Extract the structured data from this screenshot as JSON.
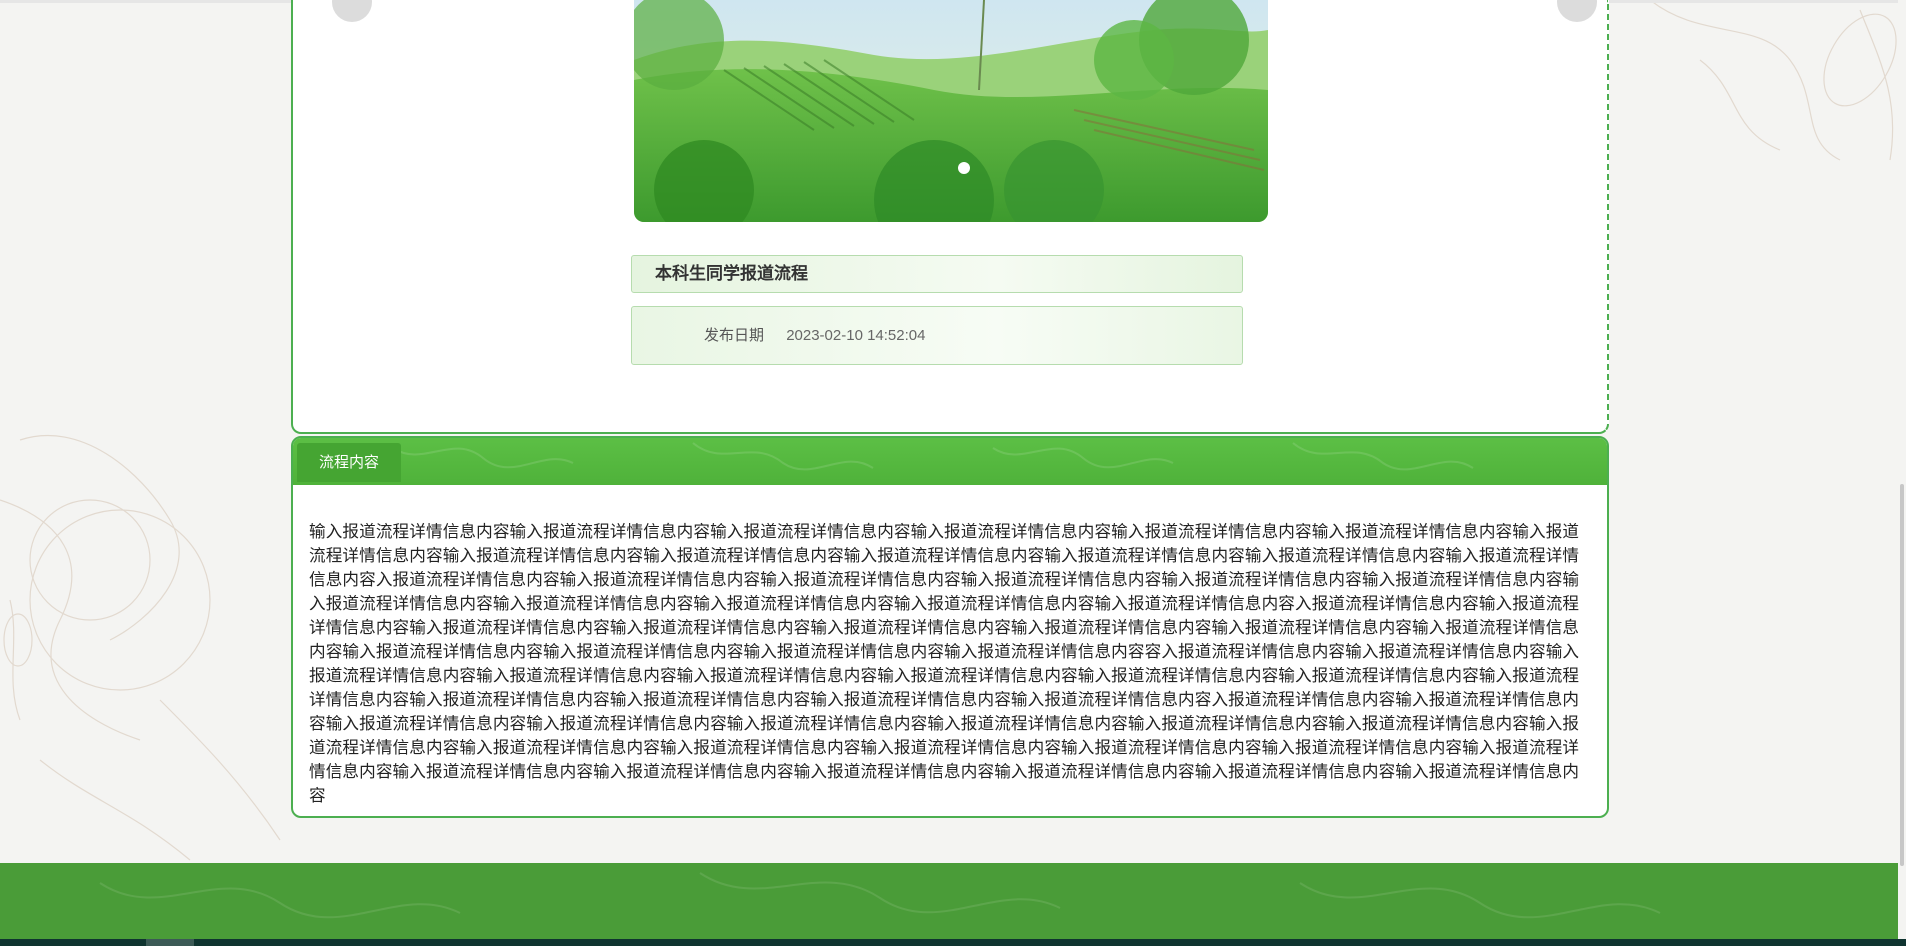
{
  "article": {
    "title": "本科生同学报道流程",
    "date_label": "发布日期",
    "date_value": "2023-02-10 14:52:04"
  },
  "content_section": {
    "tab_label": "流程内容",
    "body": "输入报道流程详情信息内容输入报道流程详情信息内容输入报道流程详情信息内容输入报道流程详情信息内容输入报道流程详情信息内容输入报道流程详情信息内容输入报道流程详情信息内容输入报道流程详情信息内容输入报道流程详情信息内容输入报道流程详情信息内容输入报道流程详情信息内容输入报道流程详情信息内容输入报道流程详情信息内容入报道流程详情信息内容输入报道流程详情信息内容输入报道流程详情信息内容输入报道流程详情信息内容输入报道流程详情信息内容输入报道流程详情信息内容输入报道流程详情信息内容输入报道流程详情信息内容输入报道流程详情信息内容输入报道流程详情信息内容输入报道流程详情信息内容入报道流程详情信息内容输入报道流程详情信息内容输入报道流程详情信息内容输入报道流程详情信息内容输入报道流程详情信息内容输入报道流程详情信息内容输入报道流程详情信息内容输入报道流程详情信息内容输入报道流程详情信息内容输入报道流程详情信息内容输入报道流程详情信息内容输入报道流程详情信息内容容入报道流程详情信息内容输入报道流程详情信息内容输入报道流程详情信息内容输入报道流程详情信息内容输入报道流程详情信息内容输入报道流程详情信息内容输入报道流程详情信息内容输入报道流程详情信息内容输入报道流程详情信息内容输入报道流程详情信息内容输入报道流程详情信息内容输入报道流程详情信息内容输入报道流程详情信息内容入报道流程详情信息内容输入报道流程详情信息内容输入报道流程详情信息内容输入报道流程详情信息内容输入报道流程详情信息内容输入报道流程详情信息内容输入报道流程详情信息内容输入报道流程详情信息内容输入报道流程详情信息内容输入报道流程详情信息内容输入报道流程详情信息内容输入报道流程详情信息内容输入报道流程详情信息内容输入报道流程详情信息内容输入报道流程详情信息内容输入报道流程详情信息内容输入报道流程详情信息内容输入报道流程详情信息内容输入报道流程详情信息内容输入报道流程详情信息内容输入报道流程详情信息内容"
  },
  "carousel": {
    "image_icon": "landscape-banner",
    "dot_count_visible": 1
  },
  "colors": {
    "accent": "#4caf50",
    "header_green": "#5cbf45",
    "tab_green": "#45a532",
    "footer_green": "#4a9c38",
    "bottom_bar": "#0f3430"
  }
}
